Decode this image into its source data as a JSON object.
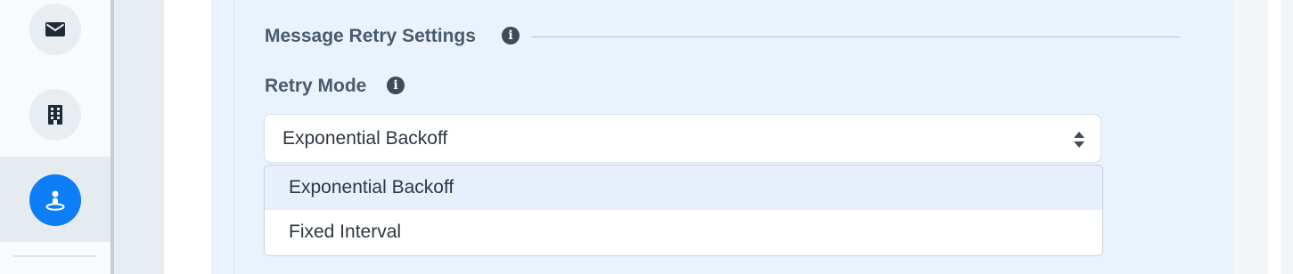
{
  "sidebar": {
    "items": [
      {
        "icon": "mail-icon",
        "active": false
      },
      {
        "icon": "building-icon",
        "active": false
      },
      {
        "icon": "person-pin-icon",
        "active": true
      }
    ]
  },
  "settings": {
    "section_title": "Message Retry Settings",
    "retry_mode": {
      "label": "Retry Mode",
      "selected": "Exponential Backoff",
      "options": [
        "Exponential Backoff",
        "Fixed Interval"
      ],
      "highlighted_option": "Exponential Backoff"
    }
  },
  "colors": {
    "accent": "#0d7ef5",
    "panel_background": "#eaf3fd",
    "option_highlight": "#e7effc"
  }
}
